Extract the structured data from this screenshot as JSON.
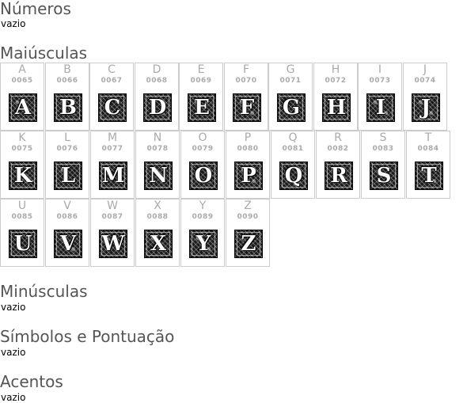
{
  "sections": {
    "numeros": {
      "title": "Números",
      "empty": "vazio"
    },
    "maiusculas": {
      "title": "Maiúsculas"
    },
    "minusculas": {
      "title": "Minúsculas",
      "empty": "vazio"
    },
    "simbolos": {
      "title": "Símbolos e Pontuação",
      "empty": "vazio"
    },
    "acentos": {
      "title": "Acentos",
      "empty": "vazio"
    }
  },
  "glyphs": [
    {
      "char": "A",
      "code": "0065"
    },
    {
      "char": "B",
      "code": "0066"
    },
    {
      "char": "C",
      "code": "0067"
    },
    {
      "char": "D",
      "code": "0068"
    },
    {
      "char": "E",
      "code": "0069"
    },
    {
      "char": "F",
      "code": "0070"
    },
    {
      "char": "G",
      "code": "0071"
    },
    {
      "char": "H",
      "code": "0072"
    },
    {
      "char": "I",
      "code": "0073"
    },
    {
      "char": "J",
      "code": "0074"
    },
    {
      "char": "K",
      "code": "0075"
    },
    {
      "char": "L",
      "code": "0076"
    },
    {
      "char": "M",
      "code": "0077"
    },
    {
      "char": "N",
      "code": "0078"
    },
    {
      "char": "O",
      "code": "0079"
    },
    {
      "char": "P",
      "code": "0080"
    },
    {
      "char": "Q",
      "code": "0081"
    },
    {
      "char": "R",
      "code": "0082"
    },
    {
      "char": "S",
      "code": "0083"
    },
    {
      "char": "T",
      "code": "0084"
    },
    {
      "char": "U",
      "code": "0085"
    },
    {
      "char": "V",
      "code": "0086"
    },
    {
      "char": "W",
      "code": "0087"
    },
    {
      "char": "X",
      "code": "0088"
    },
    {
      "char": "Y",
      "code": "0089"
    },
    {
      "char": "Z",
      "code": "0090"
    }
  ]
}
